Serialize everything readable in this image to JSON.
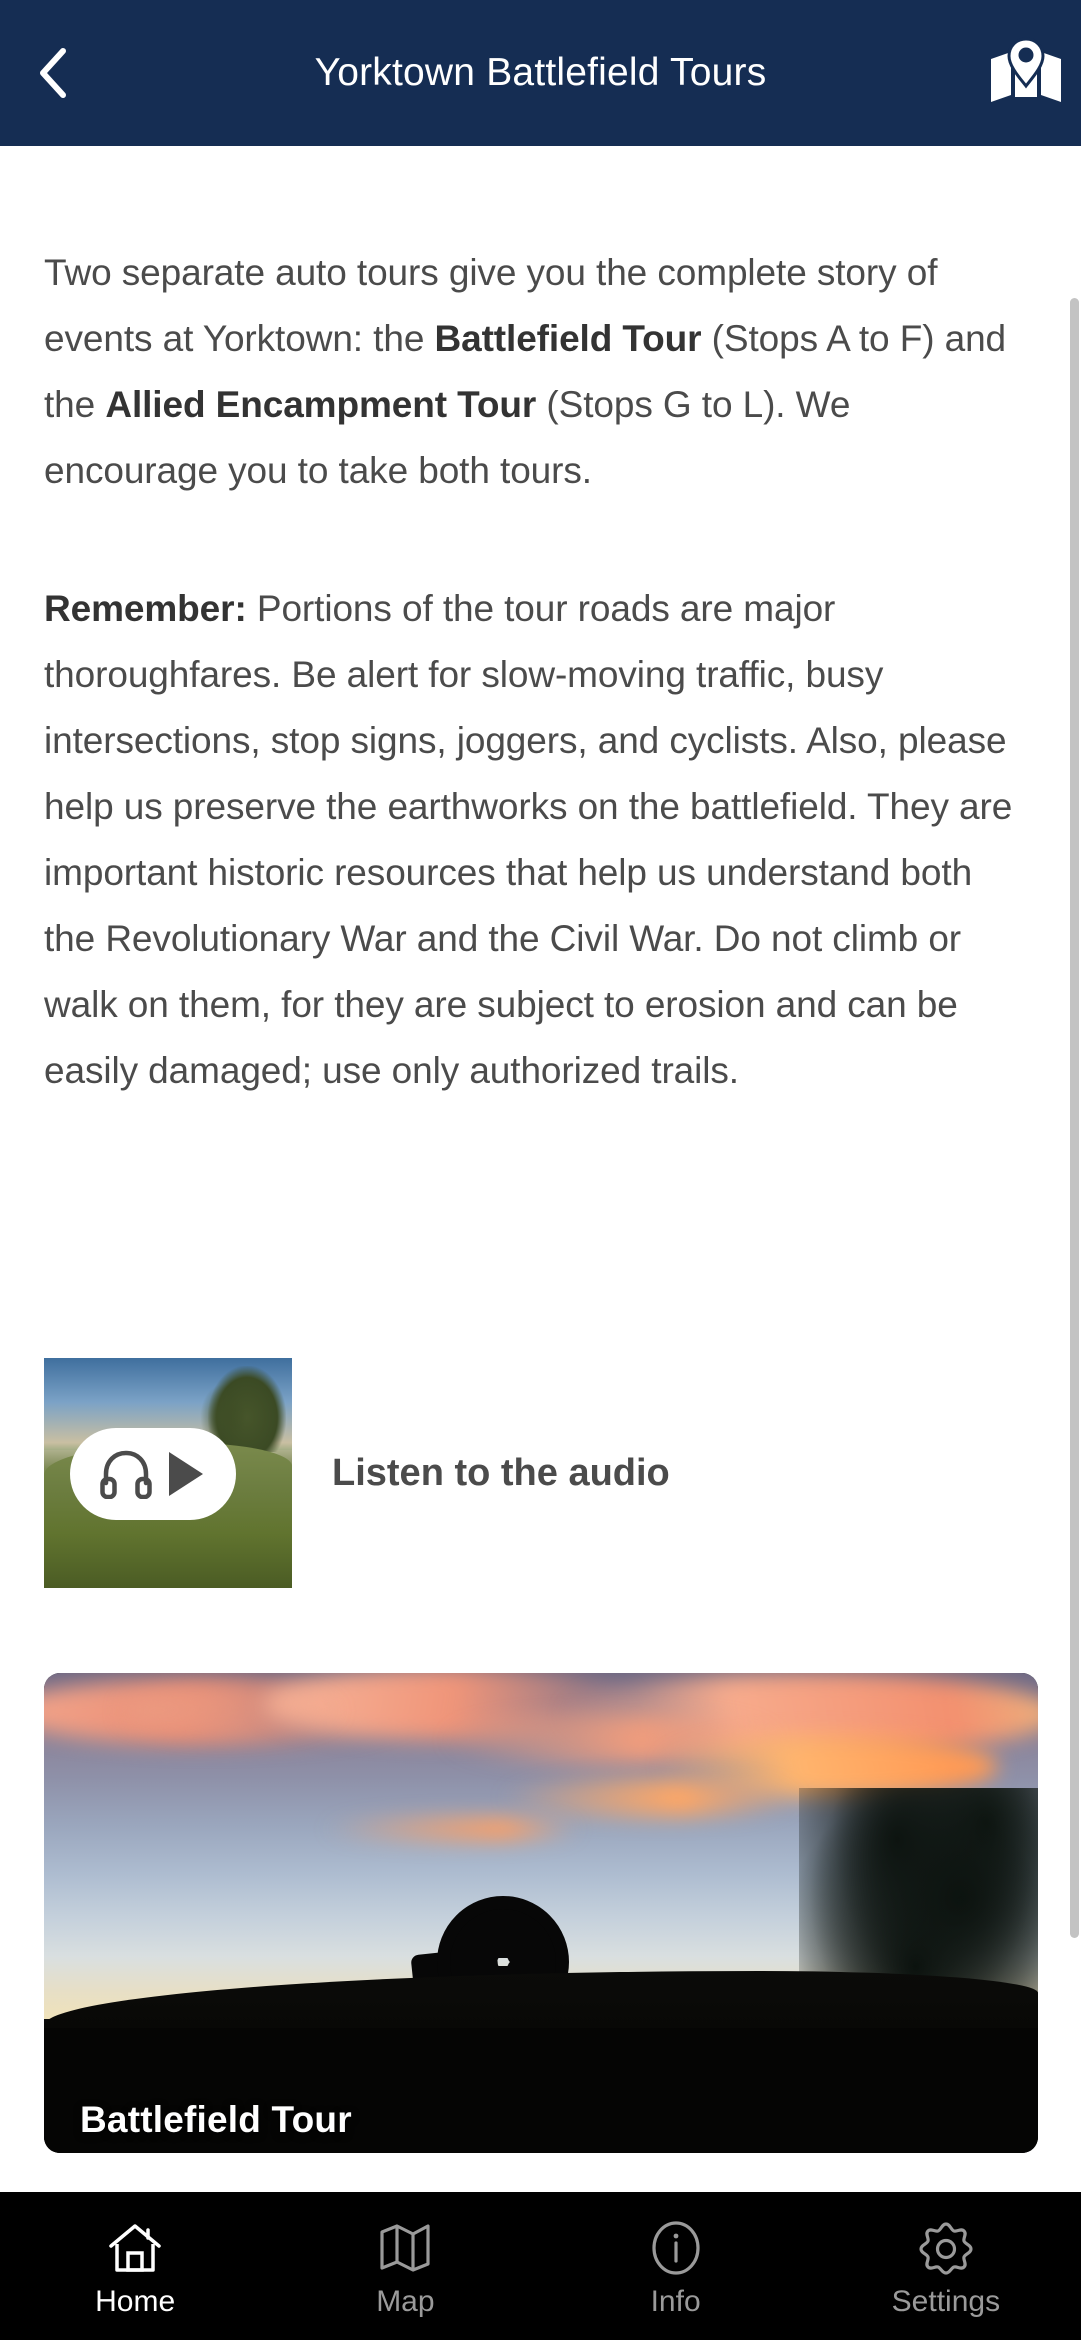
{
  "header": {
    "title": "Yorktown Battlefield Tours",
    "back_icon": "chevron-left-icon",
    "map_icon": "map-pin-icon",
    "background_color": "#152d53",
    "title_color": "#ffffff"
  },
  "content": {
    "paragraph1": {
      "part1": "Two separate auto tours give you the complete story of events at Yorktown: the ",
      "bold1": "Battlefield Tour",
      "part2": " (Stops A to F) and the ",
      "bold2": "Allied Encampment Tour",
      "part3": " (Stops G to L). We encourage you to take both tours."
    },
    "paragraph2": {
      "bold1": "Remember:",
      "part1": " Portions of the tour roads are major thoroughfares. Be alert for slow-moving traffic, busy intersections, stop signs, joggers, and cyclists. Also, please help us preserve the earthworks on the battlefield. They are important historic resources that help us understand both the Revolutionary War and the Civil War. Do not climb or walk on them, for they are subject to erosion and can be easily damaged; use only authorized trails."
    },
    "audio": {
      "label": "Listen to the audio",
      "headphones_icon": "headphones-icon",
      "play_icon": "play-icon",
      "thumbnail_alt": "grass-field-at-dusk-thumbnail"
    },
    "tour_card": {
      "title": "Battlefield Tour",
      "image_alt": "cannon-silhouette-at-sunset"
    },
    "text_color": "#4b4b4b"
  },
  "scrollbar": {
    "thumb_color": "#c3c3c3"
  },
  "bottom_nav": {
    "background_color": "#000000",
    "active_color": "#ffffff",
    "inactive_color": "#9a9a9a",
    "items": [
      {
        "label": "Home",
        "icon": "home-icon",
        "active": true
      },
      {
        "label": "Map",
        "icon": "map-icon",
        "active": false
      },
      {
        "label": "Info",
        "icon": "info-icon",
        "active": false
      },
      {
        "label": "Settings",
        "icon": "gear-icon",
        "active": false
      }
    ]
  }
}
